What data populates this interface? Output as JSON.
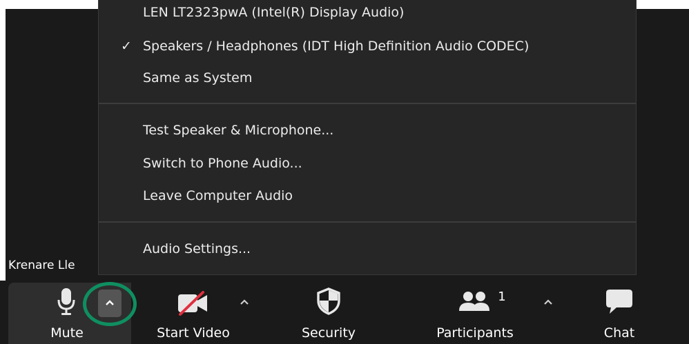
{
  "audio_menu": {
    "speaker_devices": [
      {
        "label": "LEN LT2323pwA (Intel(R) Display Audio)",
        "checked": false
      },
      {
        "label": "Speakers / Headphones (IDT High Definition Audio CODEC)",
        "checked": true
      },
      {
        "label": "Same as System",
        "checked": false
      }
    ],
    "check_glyph": "✓",
    "actions": [
      {
        "label": "Test Speaker & Microphone..."
      },
      {
        "label": "Switch to Phone Audio..."
      },
      {
        "label": "Leave Computer Audio"
      }
    ],
    "settings": {
      "label": "Audio Settings..."
    }
  },
  "participant_name": "Krenare Lle",
  "toolbar": {
    "mute": {
      "label": "Mute",
      "icon": "microphone-icon"
    },
    "video": {
      "label": "Start Video",
      "icon": "video-off-icon"
    },
    "security": {
      "label": "Security",
      "icon": "shield-icon"
    },
    "participants": {
      "label": "Participants",
      "icon": "participants-icon",
      "count": "1"
    },
    "chat": {
      "label": "Chat",
      "icon": "chat-bubble-icon"
    }
  },
  "colors": {
    "highlight_ring": "#0f8f61",
    "video_off_slash": "#e02f3f",
    "menu_background": "#262626",
    "toolbar_background": "#1a1a1a"
  }
}
